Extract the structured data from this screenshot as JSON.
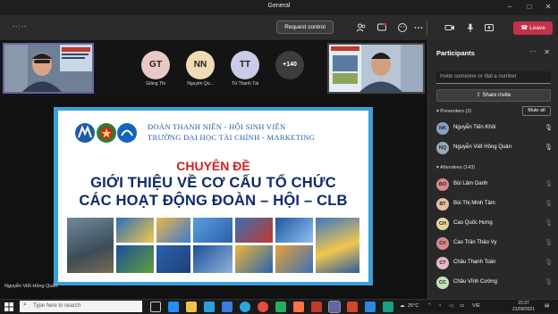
{
  "window": {
    "title": "General",
    "minimize": "–",
    "maximize": "□",
    "close": "✕"
  },
  "toolbar": {
    "timer": "--:--",
    "request_control": "Request control",
    "leave": "Leave",
    "icons": [
      "people-icon",
      "chat-icon",
      "reactions-icon",
      "more-icon",
      "camera-icon",
      "mic-icon",
      "share-tray-icon"
    ]
  },
  "strip": {
    "avatars": [
      {
        "initials": "GT",
        "name": "Giảng Thi",
        "color": "#e8c9c6"
      },
      {
        "initials": "NN",
        "name": "Nguyễn Qu...",
        "color": "#efdcb5"
      },
      {
        "initials": "TT",
        "name": "Từ Thanh Tài",
        "color": "#c9cbe8"
      }
    ],
    "overflow": "+140"
  },
  "slide": {
    "org_line1": "ĐOÀN THANH NIÊN - HỘI SINH VIÊN",
    "org_line2": "TRƯỜNG ĐẠI HỌC TÀI CHÍNH - MARKETING",
    "heading_red": "CHUYÊN ĐỀ",
    "heading_line1": "GIỚI THIỆU VỀ CƠ CẤU TỔ CHỨC",
    "heading_line2": "CÁC HOẠT ĐỘNG ĐOÀN – HỘI – CLB"
  },
  "presenter_label": "Nguyễn Viết Hồng Quân",
  "panel": {
    "title": "Participants",
    "invite_placeholder": "Invite someone or dial a number",
    "share_invite": "Share invite",
    "presenters_header": "Presenters (2)",
    "mute_all": "Mute all",
    "presenters": [
      {
        "name": "Nguyễn Tiến Khôi",
        "initials": "NK",
        "color": "#8aa0c0"
      },
      {
        "name": "Nguyễn Viết Hồng Quân",
        "initials": "NQ",
        "color": "#9aa8b8"
      }
    ],
    "attendees_header": "Attendees (143)",
    "attendees": [
      {
        "name": "Bùi Lâm Oanh",
        "initials": "BO",
        "color": "#d98a8a"
      },
      {
        "name": "Bùi Thị Minh Tâm",
        "initials": "BT",
        "color": "#e6c1a5"
      },
      {
        "name": "Cao Quốc Hưng",
        "initials": "CH",
        "color": "#e6d59a"
      },
      {
        "name": "Cao Trần Thảo Vy",
        "initials": "CV",
        "color": "#d98a8a"
      },
      {
        "name": "Châu Thanh Toàn",
        "initials": "CT",
        "color": "#e7b8c8"
      },
      {
        "name": "Châu Vĩnh Cường",
        "initials": "CC",
        "color": "#c6e0b8"
      }
    ]
  },
  "taskbar": {
    "search_placeholder": "Type here to search",
    "weather": "25°C",
    "lang": "VIE",
    "time": "15:37",
    "date": "21/09/2021"
  }
}
